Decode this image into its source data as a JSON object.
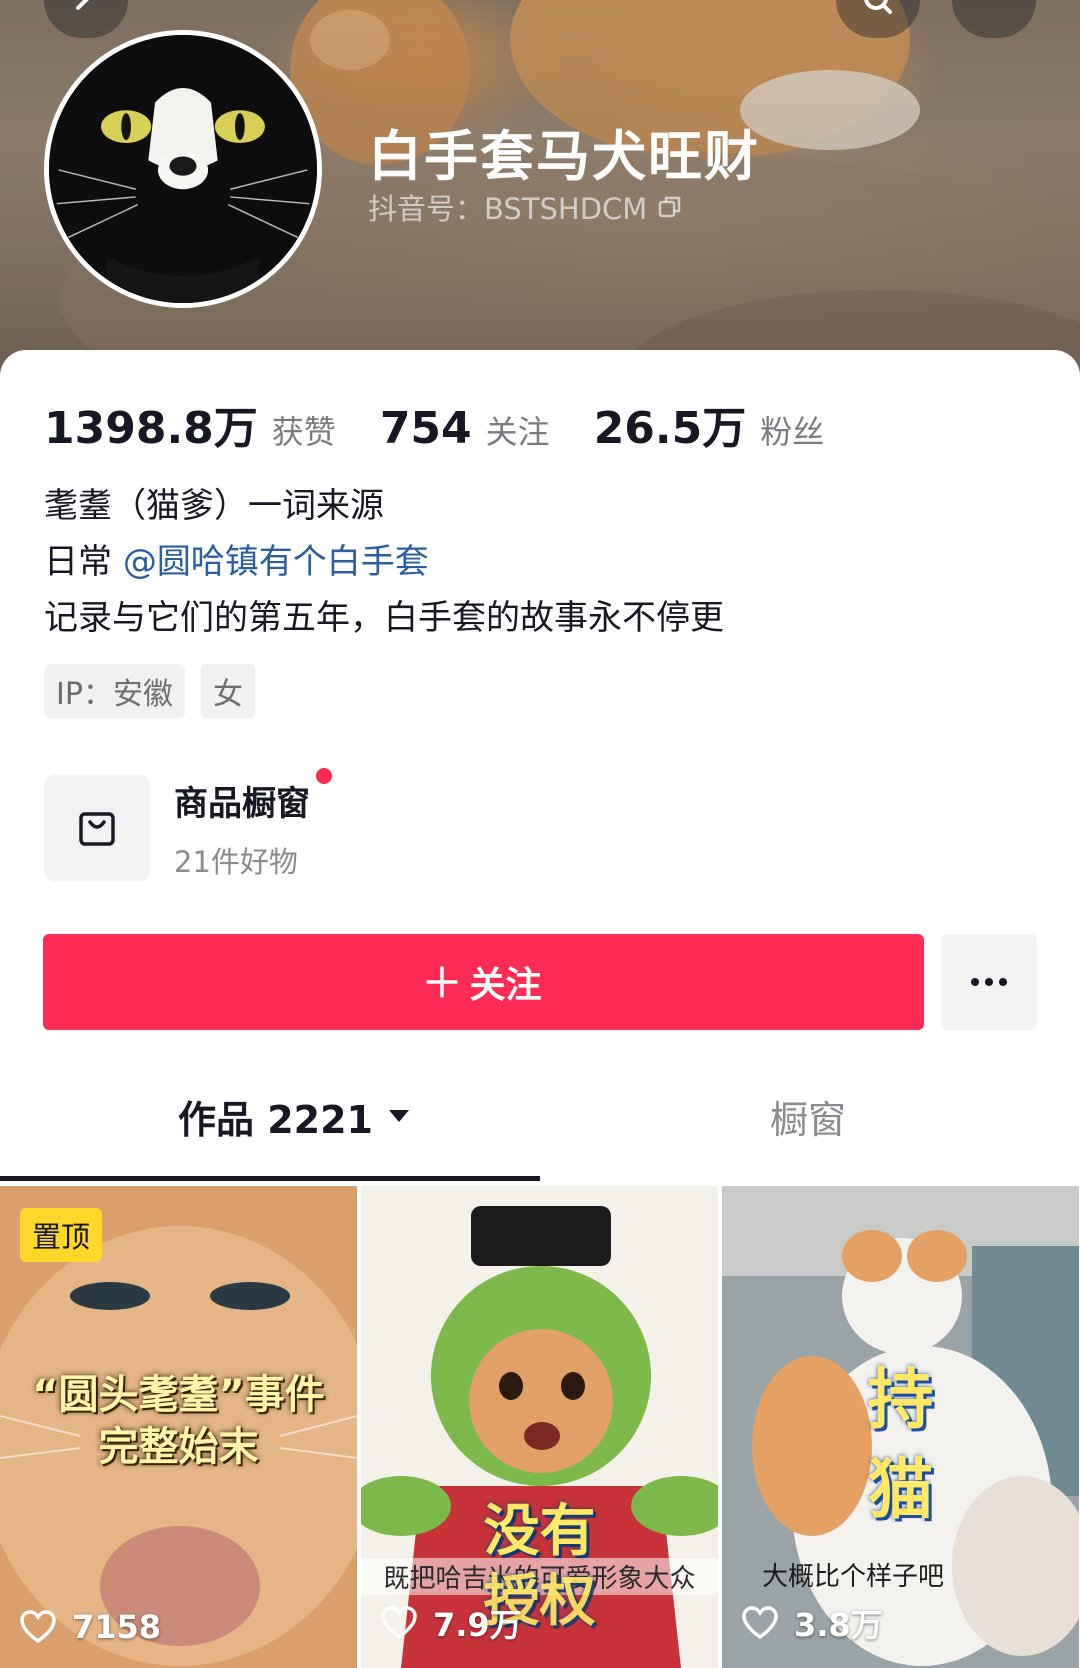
{
  "profile": {
    "nickname": "白手套马犬旺财",
    "douyin_id_label": "抖音号：BSTSHDCM"
  },
  "stats": [
    {
      "value": "1398.8万",
      "label": "获赞"
    },
    {
      "value": "754",
      "label": "关注"
    },
    {
      "value": "26.5万",
      "label": "粉丝"
    }
  ],
  "bio": {
    "line1": "耄耋（猫爹）一词来源",
    "line2_prefix": "日常 ",
    "line2_mention": "@圆哈镇有个白手套",
    "line3": "记录与它们的第五年，白手套的故事永不停更"
  },
  "tags": [
    "IP：安徽",
    "女"
  ],
  "shop": {
    "title": "商品橱窗",
    "subtitle": "21件好物",
    "has_badge": true
  },
  "actions": {
    "follow_label": "关注",
    "more_icon": "ellipsis-icon"
  },
  "tabs": {
    "works_label": "作品 2221",
    "window_label": "橱窗",
    "active": "works"
  },
  "videos": [
    {
      "badge": "置顶",
      "title_line1": "“圆头耄耋”事件",
      "title_line2": "完整始末",
      "likes": "7158"
    },
    {
      "title_line1": "没有",
      "title_line2": "授权",
      "caption": "既把哈吉米的可爱形象大众",
      "likes": "7.9万"
    },
    {
      "title_line1": "持",
      "title_line2": "猫",
      "caption": "大概比个样子吧",
      "likes": "3.8万"
    }
  ],
  "colors": {
    "accent": "#fe2c55",
    "mention": "#2c5d9e",
    "pin_badge": "#fdd72a"
  }
}
